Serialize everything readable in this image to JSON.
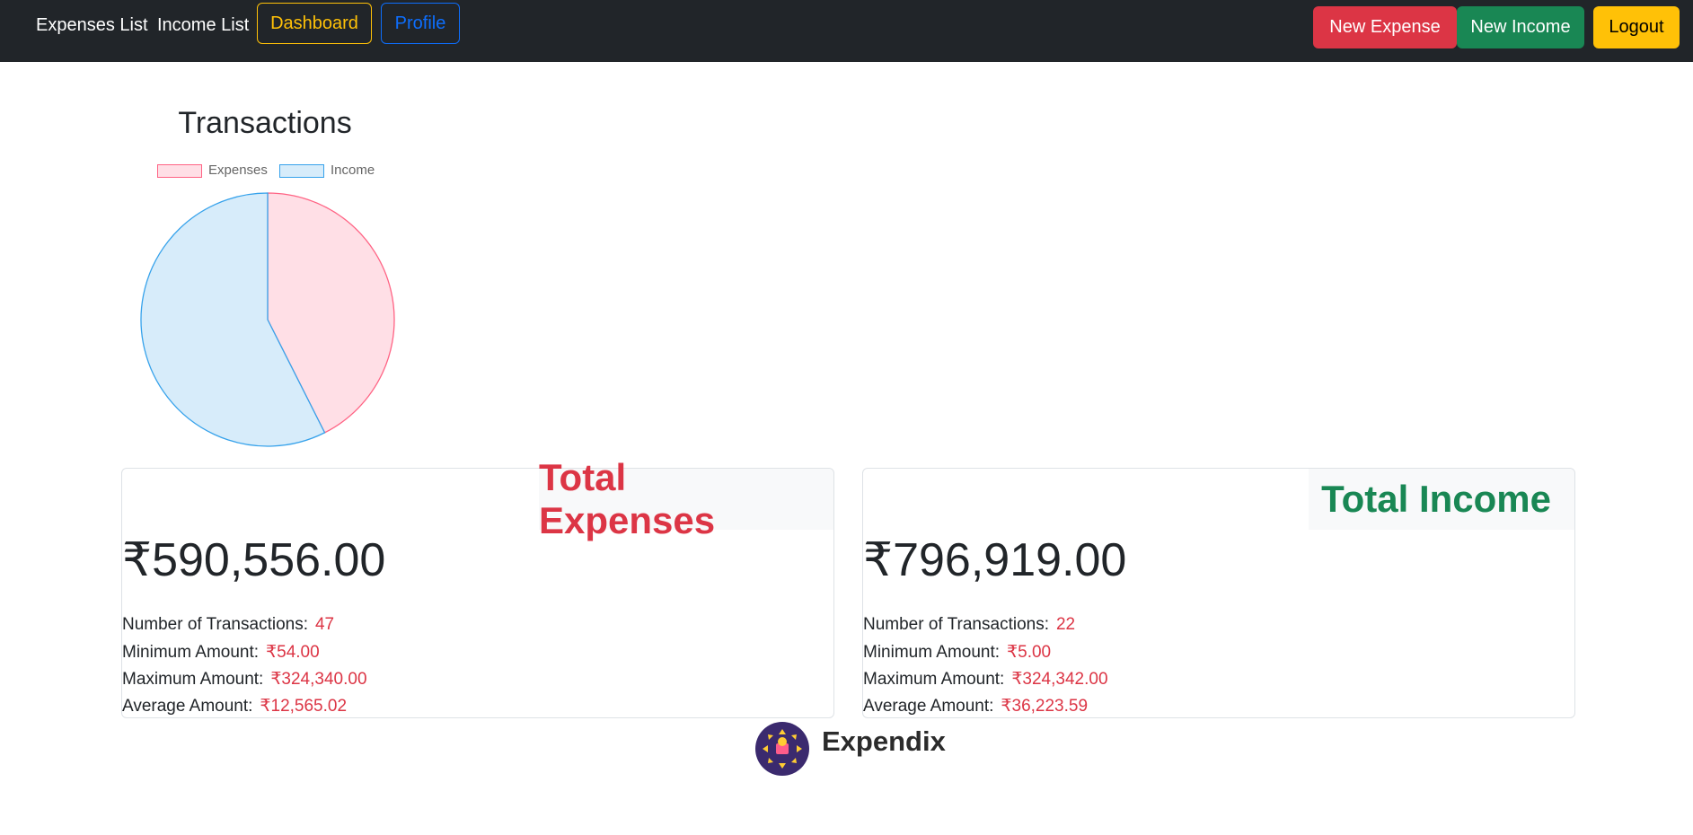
{
  "nav": {
    "expenses_list": "Expenses List",
    "income_list": "Income List",
    "dashboard": "Dashboard",
    "profile": "Profile",
    "new_expense": "New Expense",
    "new_income": "New Income",
    "logout": "Logout"
  },
  "chart_data": {
    "type": "pie",
    "title": "Transactions",
    "categories": [
      "Expenses",
      "Income"
    ],
    "values": [
      590556,
      796919
    ],
    "colors": [
      "#ff6384",
      "#36a2eb"
    ],
    "fill_colors": [
      "#ffdfe6",
      "#d7ecfa"
    ],
    "legend_position": "top"
  },
  "expenses_card": {
    "heading": "Total Expenses",
    "total": "₹590,556.00",
    "count_label": "Number of Transactions:",
    "count_value": "47",
    "min_label": "Minimum Amount:",
    "min_value": "₹54.00",
    "max_label": "Maximum Amount:",
    "max_value": "₹324,340.00",
    "avg_label": "Average Amount:",
    "avg_value": "₹12,565.02"
  },
  "income_card": {
    "heading": "Total Income",
    "total": "₹796,919.00",
    "count_label": "Number of Transactions:",
    "count_value": "22",
    "min_label": "Minimum Amount:",
    "min_value": "₹5.00",
    "max_label": "Maximum Amount:",
    "max_value": "₹324,342.00",
    "avg_label": "Average Amount:",
    "avg_value": "₹36,223.59"
  },
  "footer": {
    "brand": "Expendix",
    "logo_icon": "expendix-logo-icon"
  },
  "colors": {
    "navbar": "#212529",
    "danger": "#dc3545",
    "success": "#198754",
    "warning": "#ffc107",
    "primary": "#0d6efd"
  }
}
